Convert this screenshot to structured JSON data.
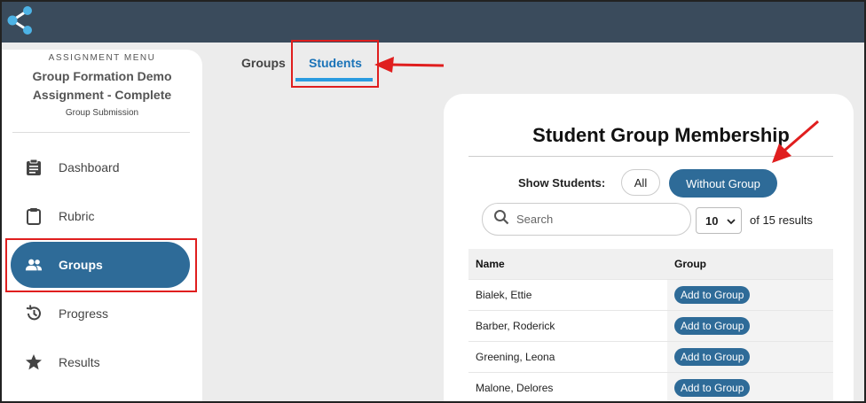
{
  "sidebar": {
    "menu_label": "ASSIGNMENT MENU",
    "assignment_title": "Group Formation Demo Assignment - Complete",
    "assignment_subtitle": "Group Submission",
    "items": [
      {
        "label": "Dashboard",
        "icon": "clipboard-icon"
      },
      {
        "label": "Rubric",
        "icon": "clipboard-outline-icon"
      },
      {
        "label": "Groups",
        "icon": "people-icon",
        "active": true
      },
      {
        "label": "Progress",
        "icon": "history-icon"
      },
      {
        "label": "Results",
        "icon": "star-icon"
      }
    ]
  },
  "tabs": [
    {
      "label": "Groups"
    },
    {
      "label": "Students",
      "active": true
    }
  ],
  "card": {
    "title": "Student Group Membership",
    "show_students_label": "Show Students:",
    "filter_all": "All",
    "filter_without": "Without Group",
    "search_placeholder": "Search",
    "page_size": "10",
    "results_text": "of 15 results",
    "table": {
      "headers": [
        "Name",
        "Group"
      ],
      "rows": [
        {
          "name": "Bialek, Ettie",
          "action": "Add to Group"
        },
        {
          "name": "Barber, Roderick",
          "action": "Add to Group"
        },
        {
          "name": "Greening, Leona",
          "action": "Add to Group"
        },
        {
          "name": "Malone, Delores",
          "action": "Add to Group"
        }
      ]
    }
  },
  "colors": {
    "topbar": "#3a4b5c",
    "accent": "#2e6b98",
    "tab_active": "#1a73b8",
    "highlight": "#e01e1e"
  }
}
